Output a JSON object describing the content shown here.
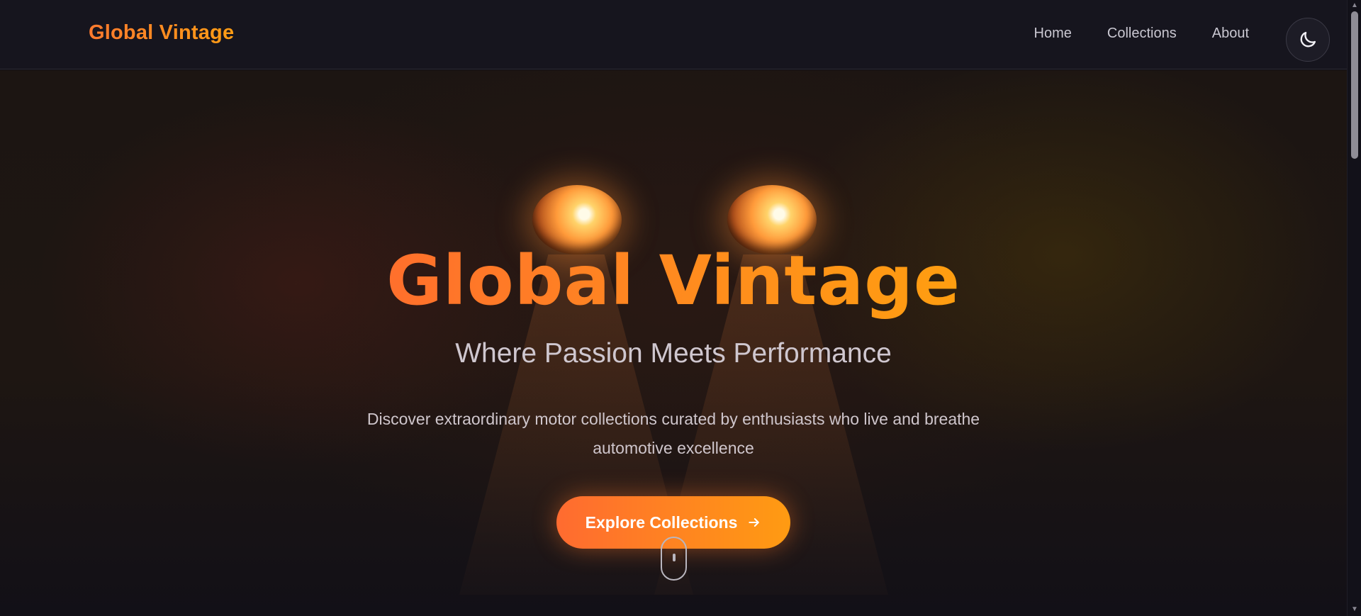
{
  "navbar": {
    "brand": "Global Vintage",
    "links": [
      "Home",
      "Collections",
      "About"
    ],
    "theme_toggle_icon": "moon-icon"
  },
  "hero": {
    "title": "Global Vintage",
    "subtitle": "Where Passion Meets Performance",
    "description": "Discover extraordinary motor collections curated by enthusiasts who live and breathe automotive excellence",
    "cta_label": "Explore Collections",
    "cta_icon": "arrow-right-icon",
    "scroll_icon": "mouse-scroll-icon"
  },
  "colors": {
    "accent_start": "#ff6b30",
    "accent_end": "#ff9b12",
    "background": "#0f0e14",
    "nav_text": "#c9c7d1"
  }
}
